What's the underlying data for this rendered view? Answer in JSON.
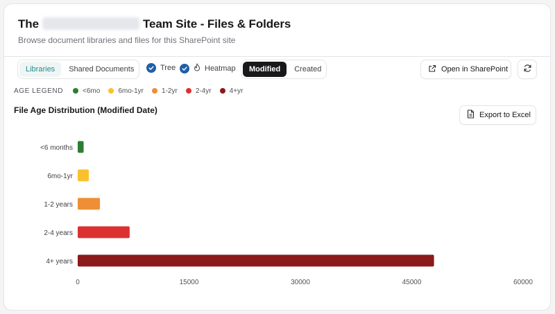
{
  "header": {
    "title_prefix": "The",
    "title_suffix": "Team Site - Files & Folders",
    "subtitle": "Browse document libraries and files for this SharePoint site"
  },
  "toolbar": {
    "view_tabs": [
      "Libraries",
      "Shared Documents"
    ],
    "toggles": [
      "Tree",
      "Heatmap"
    ],
    "date_tabs": [
      "Modified",
      "Created"
    ],
    "open_button": "Open in SharePoint"
  },
  "legend": {
    "title": "AGE LEGEND",
    "items": [
      {
        "label": "<6mo",
        "color": "#2e7d32"
      },
      {
        "label": "6mo-1yr",
        "color": "#fbc02d"
      },
      {
        "label": "1-2yr",
        "color": "#ef8f35"
      },
      {
        "label": "2-4yr",
        "color": "#dc3030"
      },
      {
        "label": "4+yr",
        "color": "#8b1a1a"
      }
    ]
  },
  "chart_section": {
    "title": "File Age Distribution (Modified Date)",
    "export_button": "Export to Excel"
  },
  "chart_data": {
    "type": "bar",
    "orientation": "horizontal",
    "categories": [
      "<6 months",
      "6mo-1yr",
      "1-2 years",
      "2-4 years",
      "4+ years"
    ],
    "values": [
      800,
      1500,
      3000,
      7000,
      48000
    ],
    "colors": [
      "#2e7d32",
      "#fbc02d",
      "#ef8f35",
      "#dc3030",
      "#8b1a1a"
    ],
    "xlim": [
      0,
      60000
    ],
    "xticks": [
      0,
      15000,
      30000,
      45000,
      60000
    ],
    "grid": false
  }
}
